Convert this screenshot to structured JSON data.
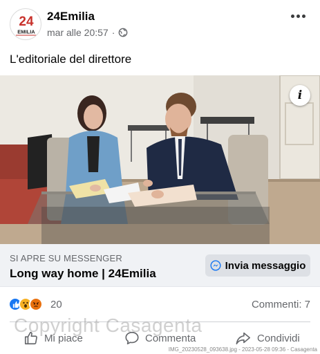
{
  "post": {
    "page_name": "24Emilia",
    "timestamp": "mar alle 20:57",
    "separator": "·",
    "privacy_icon": "globe-icon",
    "text": "L'editoriale del direttore",
    "logo": {
      "top": "24",
      "bottom": "EMILIA"
    }
  },
  "cta": {
    "caption": "SI APRE SU MESSENGER",
    "title": "Long way home | 24Emilia",
    "button_label": "Invia messaggio",
    "button_icon": "messenger-icon"
  },
  "reactions": {
    "icons": [
      "like-reaction-icon",
      "wow-reaction-icon",
      "angry-reaction-icon"
    ],
    "count": "20",
    "comments": "Commenti: 7"
  },
  "actions": {
    "like": "Mi piace",
    "comment": "Commenta",
    "share": "Condividi"
  },
  "overlay": {
    "watermark": "Copyright Casagenta",
    "file_info": "IMG_20230528_093638.jpg - 2023-05-28 09:36 - Casagenta"
  },
  "colors": {
    "like_blue": "#1877f2",
    "angry_red": "#e9710f",
    "wow_yellow": "#f7b125",
    "cta_bg": "#f0f2f5",
    "muted": "#65676b"
  }
}
